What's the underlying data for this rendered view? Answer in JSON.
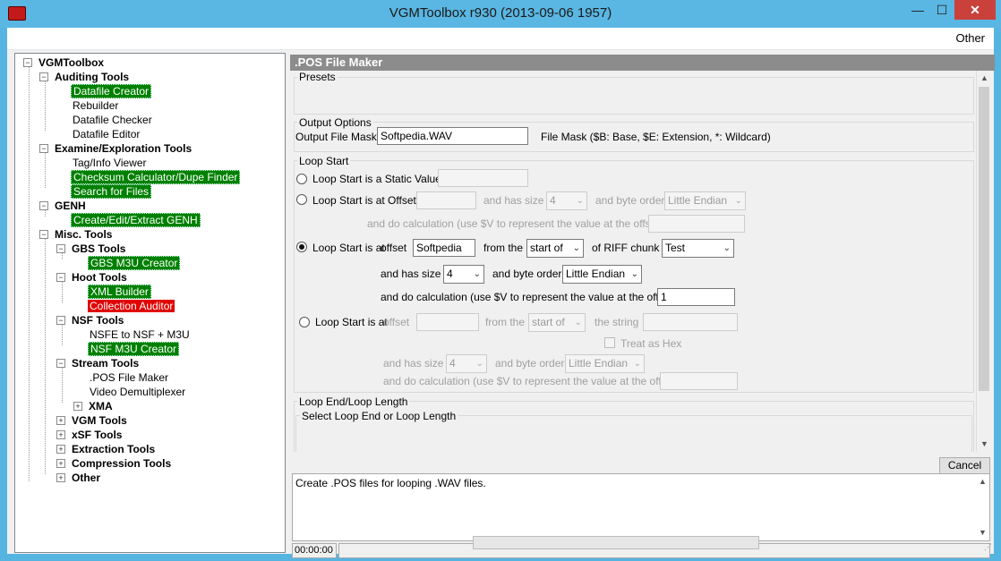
{
  "window": {
    "title": "VGMToolbox r930 (2013-09-06 1957)",
    "min_glyph": "—",
    "max_glyph": "☐",
    "close_glyph": "✕"
  },
  "menu": {
    "other": "Other"
  },
  "tree": {
    "root": "VGMToolbox",
    "auditing": "Auditing Tools",
    "datafile_creator": "Datafile Creator",
    "rebuilder": "Rebuilder",
    "datafile_checker": "Datafile Checker",
    "datafile_editor": "Datafile Editor",
    "examine": "Examine/Exploration Tools",
    "tag_viewer": "Tag/Info Viewer",
    "checksum": "Checksum Calculator/Dupe Finder",
    "search": "Search for Files",
    "genh": "GENH",
    "genh_create": "Create/Edit/Extract GENH",
    "misc": "Misc. Tools",
    "gbs": "GBS Tools",
    "gbs_m3u": "GBS M3U Creator",
    "hoot": "Hoot Tools",
    "xml_builder": "XML Builder",
    "collection_auditor": "Collection Auditor",
    "nsf": "NSF Tools",
    "nsfe_to_nsf": "NSFE to NSF + M3U",
    "nsf_m3u": "NSF M3U Creator",
    "stream": "Stream Tools",
    "pos_maker": ".POS File Maker",
    "video_demux": "Video Demultiplexer",
    "xma": "XMA",
    "vgm": "VGM Tools",
    "xsf": "xSF Tools",
    "extraction": "Extraction Tools",
    "compression": "Compression Tools",
    "other": "Other"
  },
  "panel": {
    "header": ".POS File Maker",
    "presets": "Presets",
    "output_options": "Output Options",
    "output_mask_label": "Output File Mask",
    "output_mask_value": "Softpedia.WAV",
    "file_mask_hint": "File Mask ($B: Base, $E: Extension, *: Wildcard)",
    "loop_start": "Loop Start",
    "ls_static": "Loop Start is a Static Value",
    "ls_offset": "Loop Start is at Offset",
    "and_has_size": "and has size",
    "size_4": "4",
    "and_byte_order": "and byte order",
    "little_endian": "Little Endian",
    "and_do_calc": "and do calculation (use $V to represent the value at the offset)",
    "ls_riff_a": "Loop Start is at",
    "offset_word": "offset",
    "riff_offset_value": "Softpedia",
    "from_the": "from the",
    "start_of": "start of",
    "of_riff_chunk": "of RIFF chunk",
    "riff_chunk_value": "Test",
    "riff_calc_value": "1",
    "ls_string_a": "Loop Start is at",
    "offset_word2": "offset",
    "the_string": "the string",
    "treat_as_hex": "Treat as Hex",
    "loop_end": "Loop End/Loop Length",
    "select_loop_end": "Select Loop End or Loop Length",
    "cancel": "Cancel",
    "description": "Create .POS files for looping .WAV files.",
    "time": "00:00:00"
  }
}
